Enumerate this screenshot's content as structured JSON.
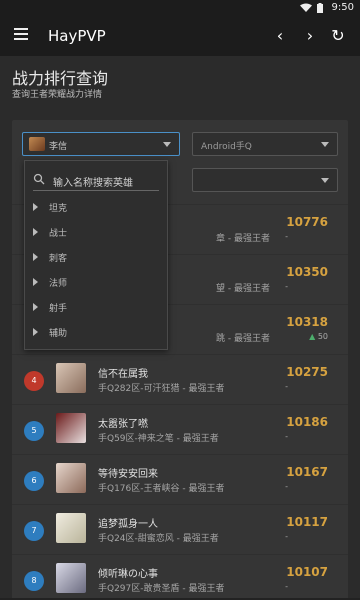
{
  "status": {
    "time": "9:50"
  },
  "appbar": {
    "title": "HayPVP",
    "back": "‹",
    "forward": "›",
    "refresh": "↻"
  },
  "header": {
    "title": "战力排行查询",
    "subtitle": "查询王者荣耀战力详情"
  },
  "filters": {
    "hero": "李信",
    "platform": "Android手Q"
  },
  "dropdown": {
    "placeholder": "输入名称搜索英雄",
    "items": [
      "坦克",
      "战士",
      "刺客",
      "法师",
      "射手",
      "辅助"
    ]
  },
  "rows": [
    {
      "rank": "",
      "name": "",
      "sub": "章 - 最强王者",
      "score": "10776",
      "dash": "-",
      "delta": ""
    },
    {
      "rank": "",
      "name": "",
      "sub": "望 - 最强王者",
      "score": "10350",
      "dash": "-",
      "delta": ""
    },
    {
      "rank": "",
      "name": "",
      "sub": "跳 - 最强王者",
      "score": "10318",
      "dash": "",
      "delta": "50"
    },
    {
      "rank": "4",
      "name": "信不在属我",
      "sub": "手Q282区-可汗狂猎 - 最强王者",
      "score": "10275",
      "dash": "-",
      "delta": ""
    },
    {
      "rank": "5",
      "name": "太嚣张了嘫",
      "sub": "手Q59区-神来之笔 - 最强王者",
      "score": "10186",
      "dash": "-",
      "delta": ""
    },
    {
      "rank": "6",
      "name": "等待安安回来",
      "sub": "手Q176区-王者峡谷 - 最强王者",
      "score": "10167",
      "dash": "-",
      "delta": ""
    },
    {
      "rank": "7",
      "name": "追梦孤身一人",
      "sub": "手Q24区-甜蜜恋风 - 最强王者",
      "score": "10117",
      "dash": "-",
      "delta": ""
    },
    {
      "rank": "8",
      "name": "倾听琳の心事",
      "sub": "手Q297区-敢贵圣盾 - 最强王者",
      "score": "10107",
      "dash": "-",
      "delta": ""
    }
  ],
  "colors": {
    "rank_red": "#c0392b",
    "rank_blue": "#2e7dbf",
    "score_gold": "#d6a240"
  }
}
